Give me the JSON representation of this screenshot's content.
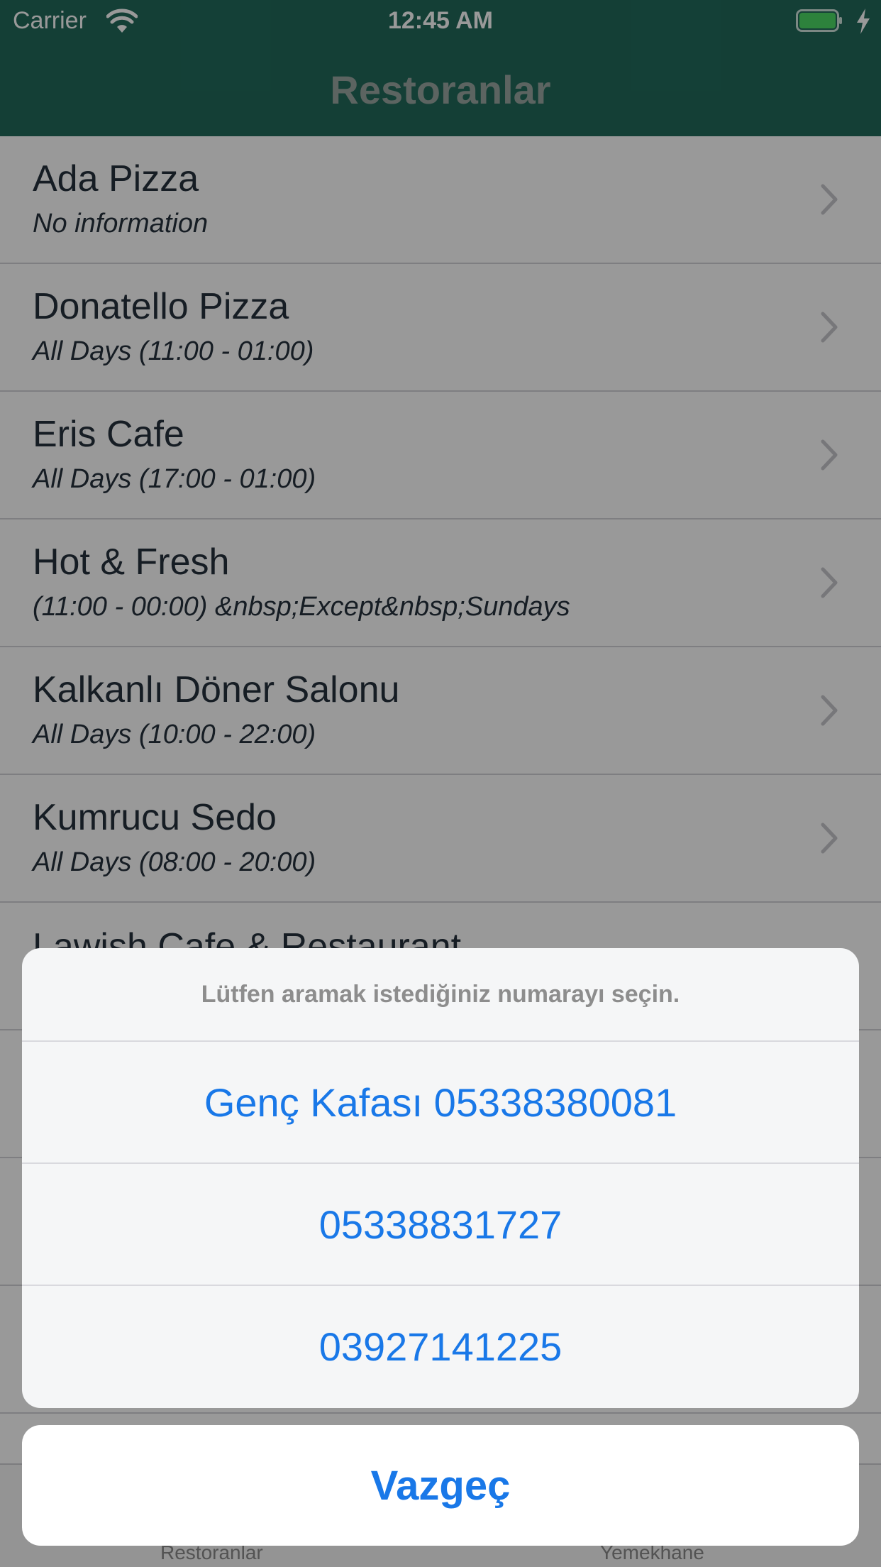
{
  "status_bar": {
    "carrier": "Carrier",
    "time": "12:45 AM"
  },
  "nav": {
    "title": "Restoranlar"
  },
  "restaurants": [
    {
      "name": "Ada Pizza",
      "hours": "No information"
    },
    {
      "name": "Donatello Pizza",
      "hours": "All Days (11:00 - 01:00)"
    },
    {
      "name": "Eris Cafe",
      "hours": "All Days (17:00 - 01:00)"
    },
    {
      "name": "Hot & Fresh",
      "hours": "(11:00 - 00:00) &nbsp;Except&nbsp;Sundays"
    },
    {
      "name": "Kalkanlı Döner Salonu",
      "hours": "All Days (10:00 - 22:00)"
    },
    {
      "name": "Kumrucu Sedo",
      "hours": "All Days (08:00 - 20:00)"
    },
    {
      "name": "Lawish Cafe & Restaurant",
      "hours": ""
    }
  ],
  "tab_bar": {
    "items": [
      {
        "label": "Restoranlar"
      },
      {
        "label": "Yemekhane"
      }
    ]
  },
  "action_sheet": {
    "title": "Lütfen aramak istediğiniz numarayı seçin.",
    "actions": [
      {
        "label": "Genç Kafası 05338380081"
      },
      {
        "label": "05338831727"
      },
      {
        "label": "03927141225"
      }
    ],
    "cancel_label": "Vazgeç"
  },
  "colors": {
    "header": "#226a5b",
    "action_blue": "#1978e8"
  }
}
